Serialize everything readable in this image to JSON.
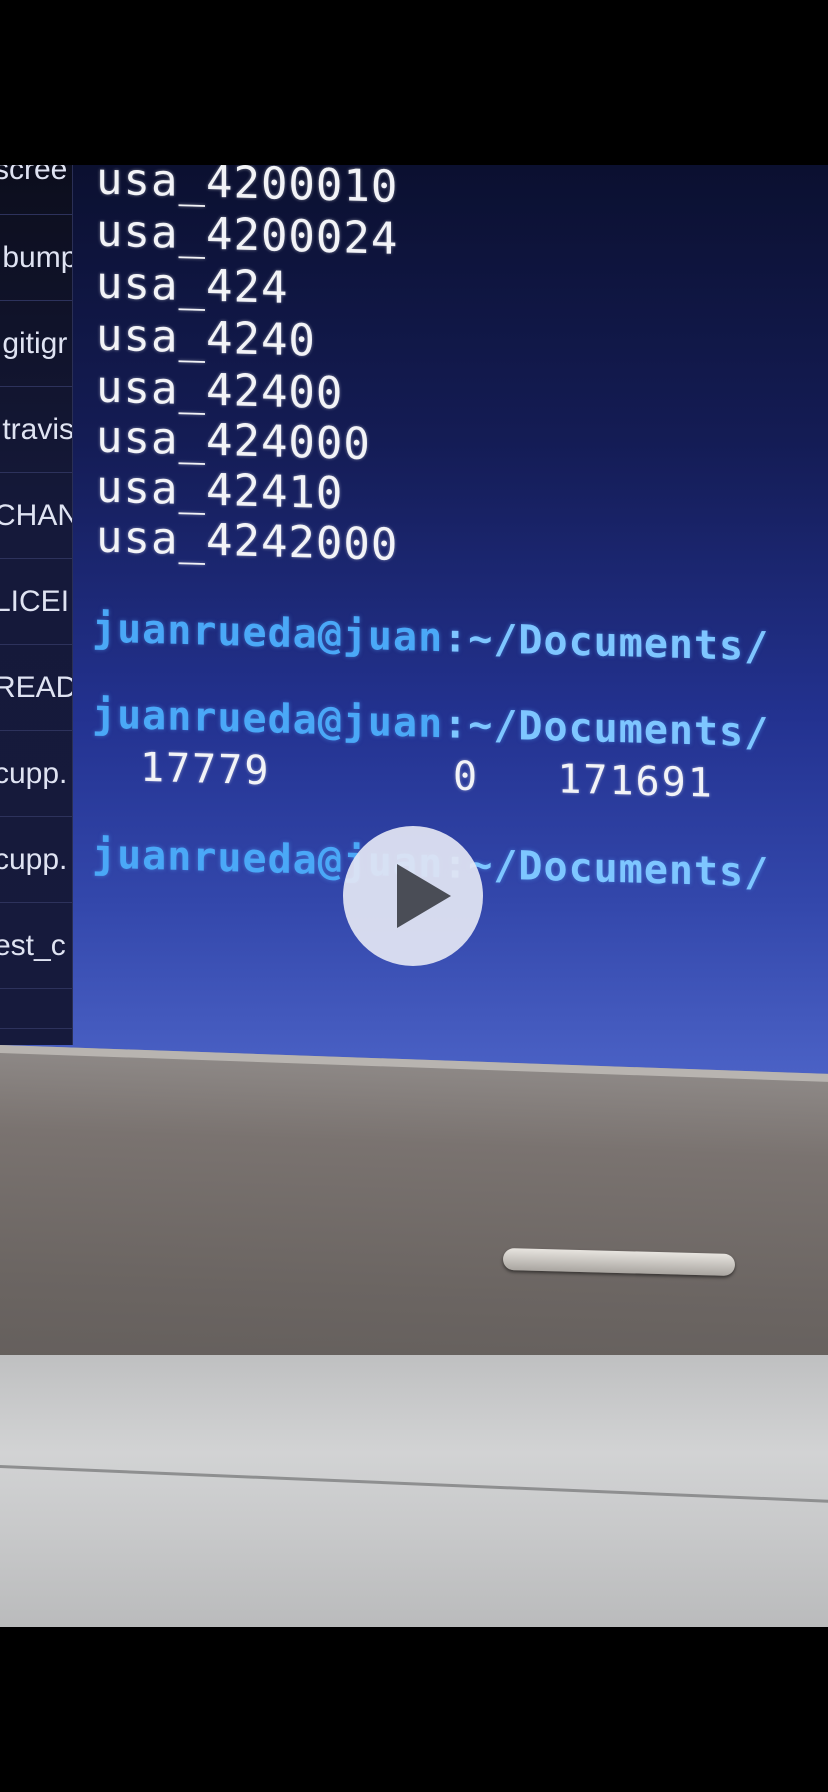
{
  "sidebar": {
    "items": [
      {
        "label": "scree"
      },
      {
        "label": ".bump"
      },
      {
        "label": ".gitigr"
      },
      {
        "label": ".travis"
      },
      {
        "label": "CHAN"
      },
      {
        "label": "LICEI"
      },
      {
        "label": "READ"
      },
      {
        "label": "cupp."
      },
      {
        "label": "cupp."
      },
      {
        "label": "est_c"
      },
      {
        "label": ""
      }
    ]
  },
  "terminal": {
    "output_lines": [
      "usa_4200010",
      "usa_4200024",
      "usa_424",
      "usa_4240",
      "usa_42400",
      "usa_424000",
      "usa_42410",
      "usa_4242000"
    ],
    "prompts": [
      {
        "user": "juanrueda@juan",
        "path": ":~/Documents/"
      },
      {
        "user": "juanrueda@juan",
        "path": ":~/Documents/"
      },
      {
        "user": "juanrueda@juan",
        "path": ":~/Documents/"
      }
    ],
    "count_output": "17779       0   171691"
  },
  "colors": {
    "prompt_user": "#4aa8f7",
    "prompt_path": "#7ec6ff",
    "output_text": "#f2f3f7"
  },
  "player": {
    "play_icon": "play-icon"
  }
}
